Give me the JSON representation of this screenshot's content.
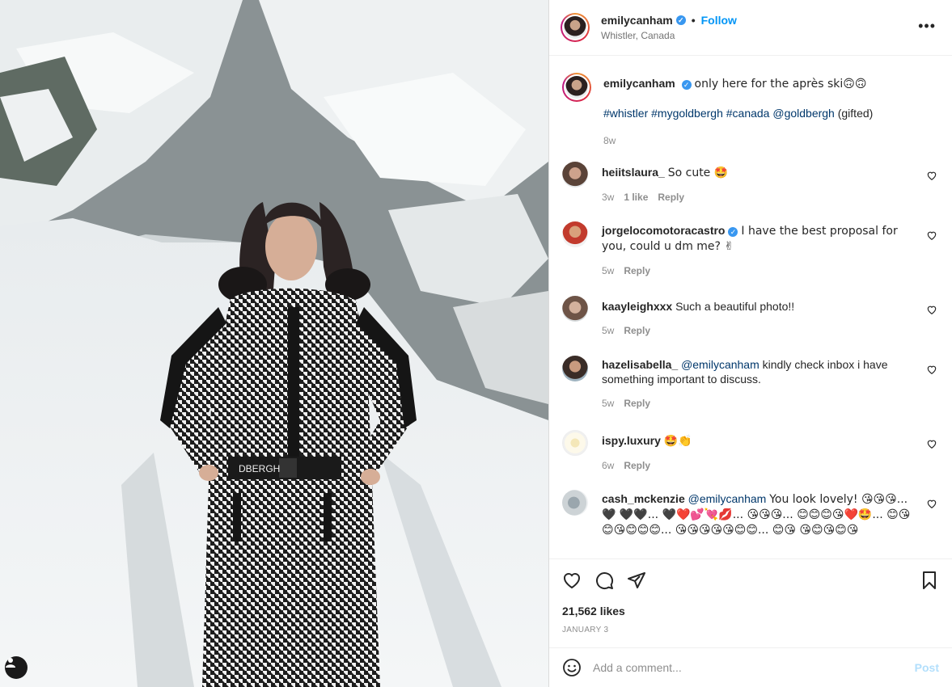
{
  "post": {
    "username": "emilycanham",
    "follow_label": "Follow",
    "location": "Whistler, Canada",
    "more_label": "•••",
    "caption_text": "only here for the après ski🙃🙃",
    "hashtags": "#whistler #mygoldbergh #canada @goldbergh",
    "gifted": "(gifted)",
    "caption_time": "8w",
    "likes": "21,562 likes",
    "date": "JANUARY 3"
  },
  "comments": [
    {
      "user": "heiitslaura_",
      "text": "So cute 🤩",
      "time": "3w",
      "likes": "1 like",
      "reply": "Reply"
    },
    {
      "user": "jorgelocomotoracastro",
      "text": "I have the best proposal for you, could u dm me? ✌",
      "time": "5w",
      "reply": "Reply"
    },
    {
      "user": "kaayleighxxx",
      "text": "Such a beautiful photo!!",
      "time": "5w",
      "reply": "Reply"
    },
    {
      "user": "hazelisabella_",
      "mention": "@emilycanham",
      "text": "kindly check inbox i have something important to discuss.",
      "time": "5w",
      "reply": "Reply"
    },
    {
      "user": "ispy.luxury",
      "text": "🤩👏",
      "time": "6w",
      "reply": "Reply"
    },
    {
      "user": "cash_mckenzie",
      "mention": "@emilycanham",
      "text": "You look lovely! 😘😘😘... 🖤 🖤🖤... 🖤❤️💕💘💋... 😘😘😘... 😊😊😊😘❤️🤩... 😊😘😊😘😊😊😊... 😘😘😘😘😘😊😊... 😊😘 😘😊😘😊😘"
    }
  ],
  "add_comment": {
    "placeholder": "Add a comment...",
    "post_label": "Post"
  },
  "colors": {
    "accent": "#0095f6",
    "verified": "#3897f0",
    "post_disabled": "#b2dffc"
  }
}
